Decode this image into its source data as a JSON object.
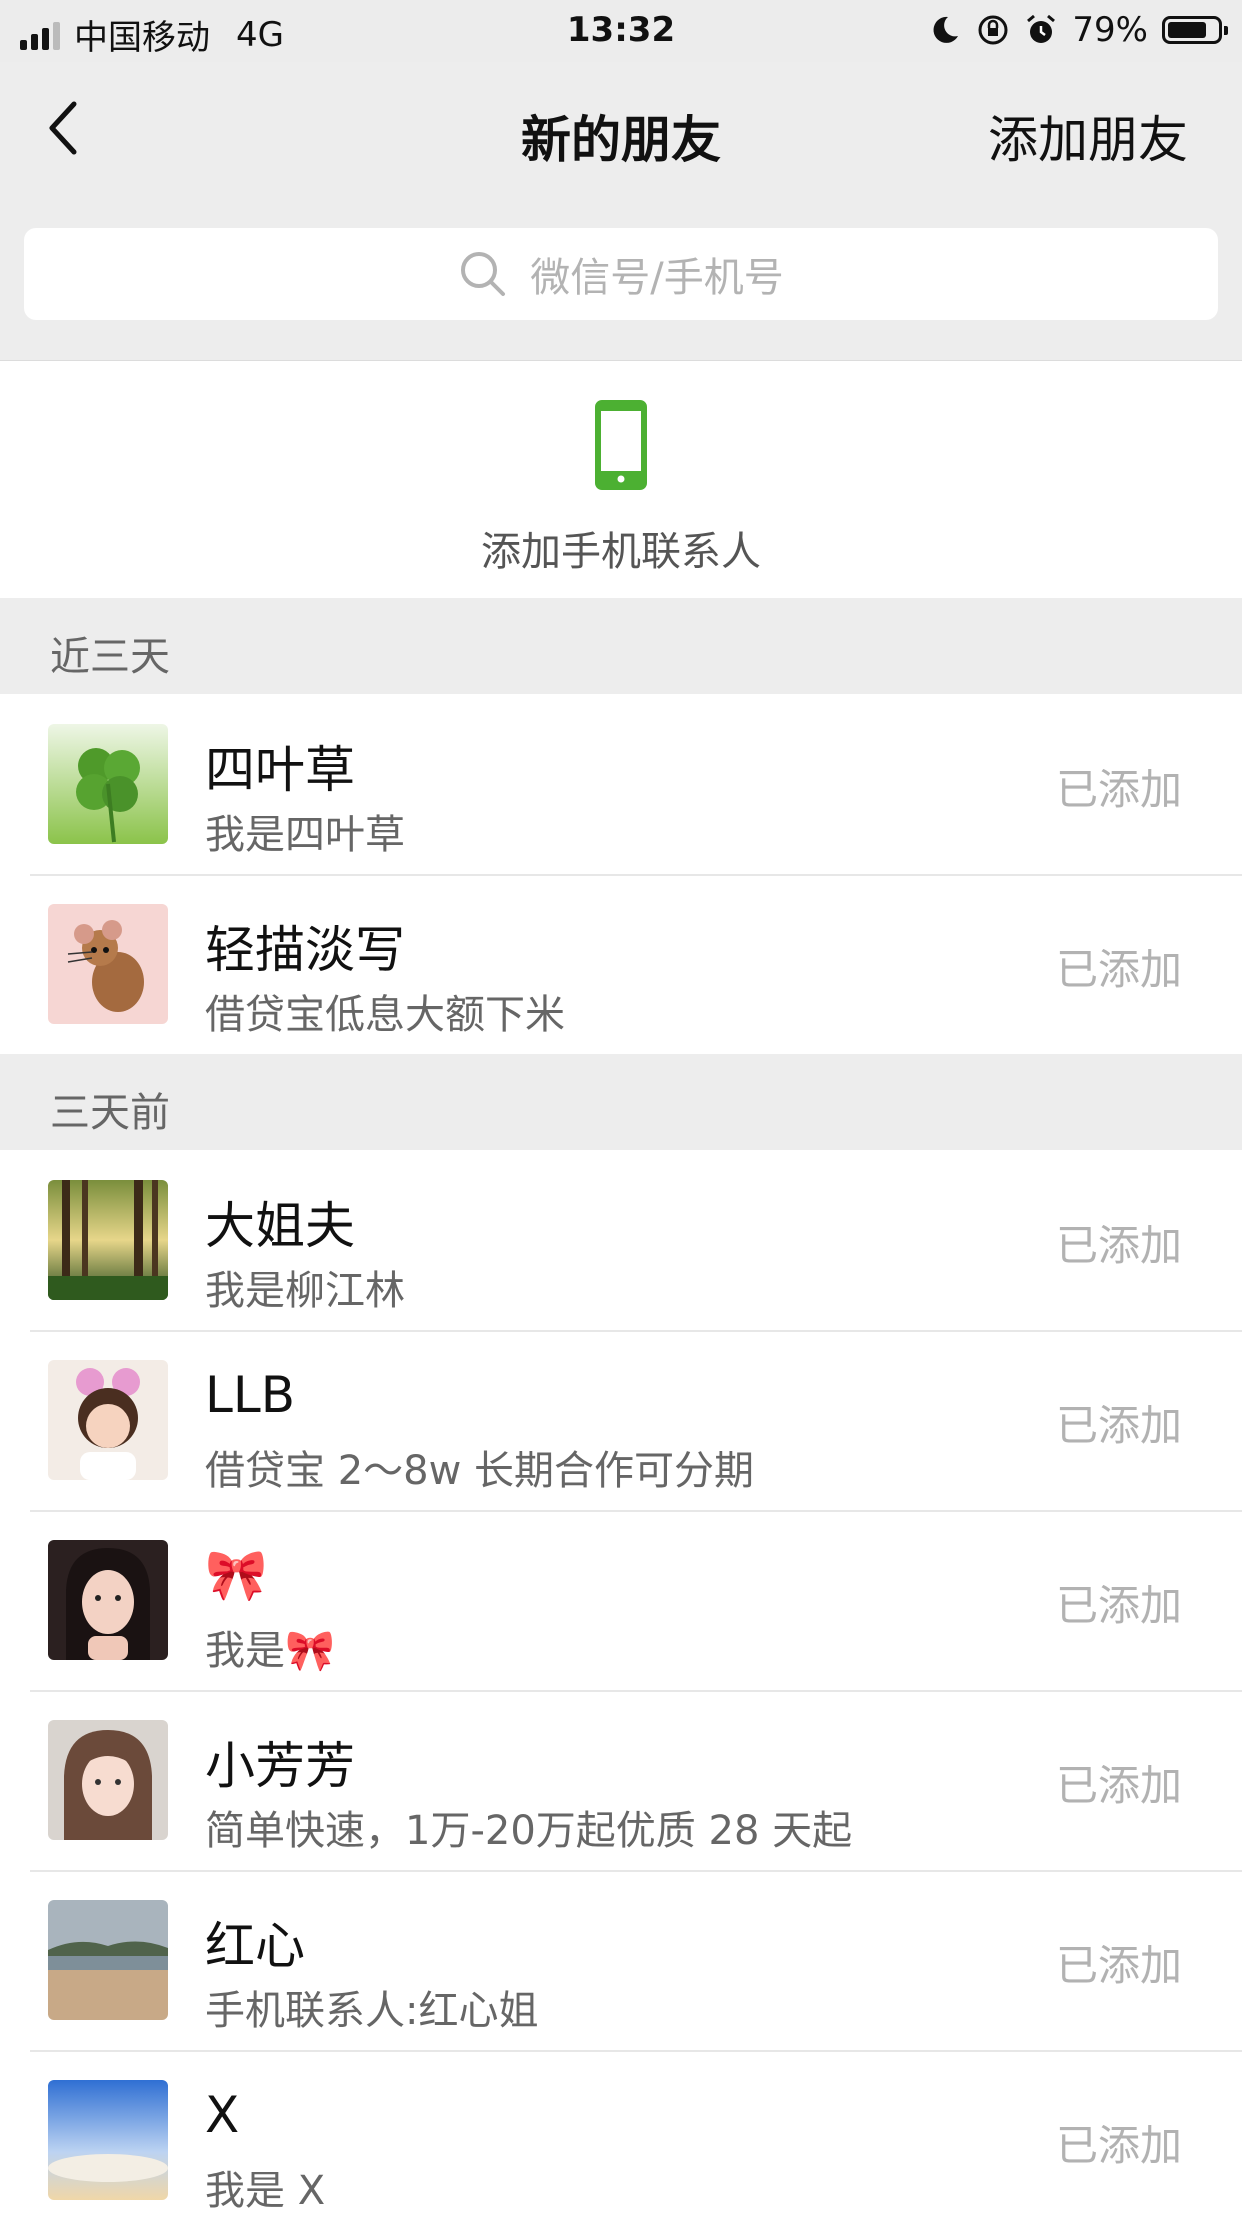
{
  "status_bar": {
    "carrier": "中国移动",
    "network": "4G",
    "time": "13:32",
    "battery": "79%",
    "battery_level": 0.79
  },
  "nav": {
    "title": "新的朋友",
    "action": "添加朋友"
  },
  "search": {
    "placeholder": "微信号/手机号"
  },
  "add_phone_contacts": {
    "label": "添加手机联系人",
    "icon_color": "#4cb032"
  },
  "sections": [
    {
      "header": "近三天",
      "items": [
        {
          "name": "四叶草",
          "subtitle": "我是四叶草",
          "status": "已添加",
          "avatar": "clover-avatar"
        },
        {
          "name": "轻描淡写",
          "subtitle": "借贷宝低息大额下米",
          "status": "已添加",
          "avatar": "cartoon-mouse-avatar"
        }
      ]
    },
    {
      "header": "三天前",
      "items": [
        {
          "name": "大姐夫",
          "subtitle": "我是柳江林",
          "status": "已添加",
          "avatar": "forest-avatar"
        },
        {
          "name": "LLB",
          "subtitle": "借贷宝 2～8w 长期合作可分期",
          "status": "已添加",
          "avatar": "child-avatar"
        },
        {
          "name": "🎀",
          "subtitle": "我是🎀",
          "status": "已添加",
          "avatar": "girl-avatar"
        },
        {
          "name": "小芳芳",
          "subtitle": "简单快速，1万-20万起优质 28 天起",
          "status": "已添加",
          "avatar": "woman-avatar"
        },
        {
          "name": "红心",
          "subtitle": "手机联系人:红心姐",
          "status": "已添加",
          "avatar": "beach-avatar"
        },
        {
          "name": "X",
          "subtitle": "我是 X",
          "status": "已添加",
          "avatar": "sky-avatar"
        }
      ]
    }
  ]
}
